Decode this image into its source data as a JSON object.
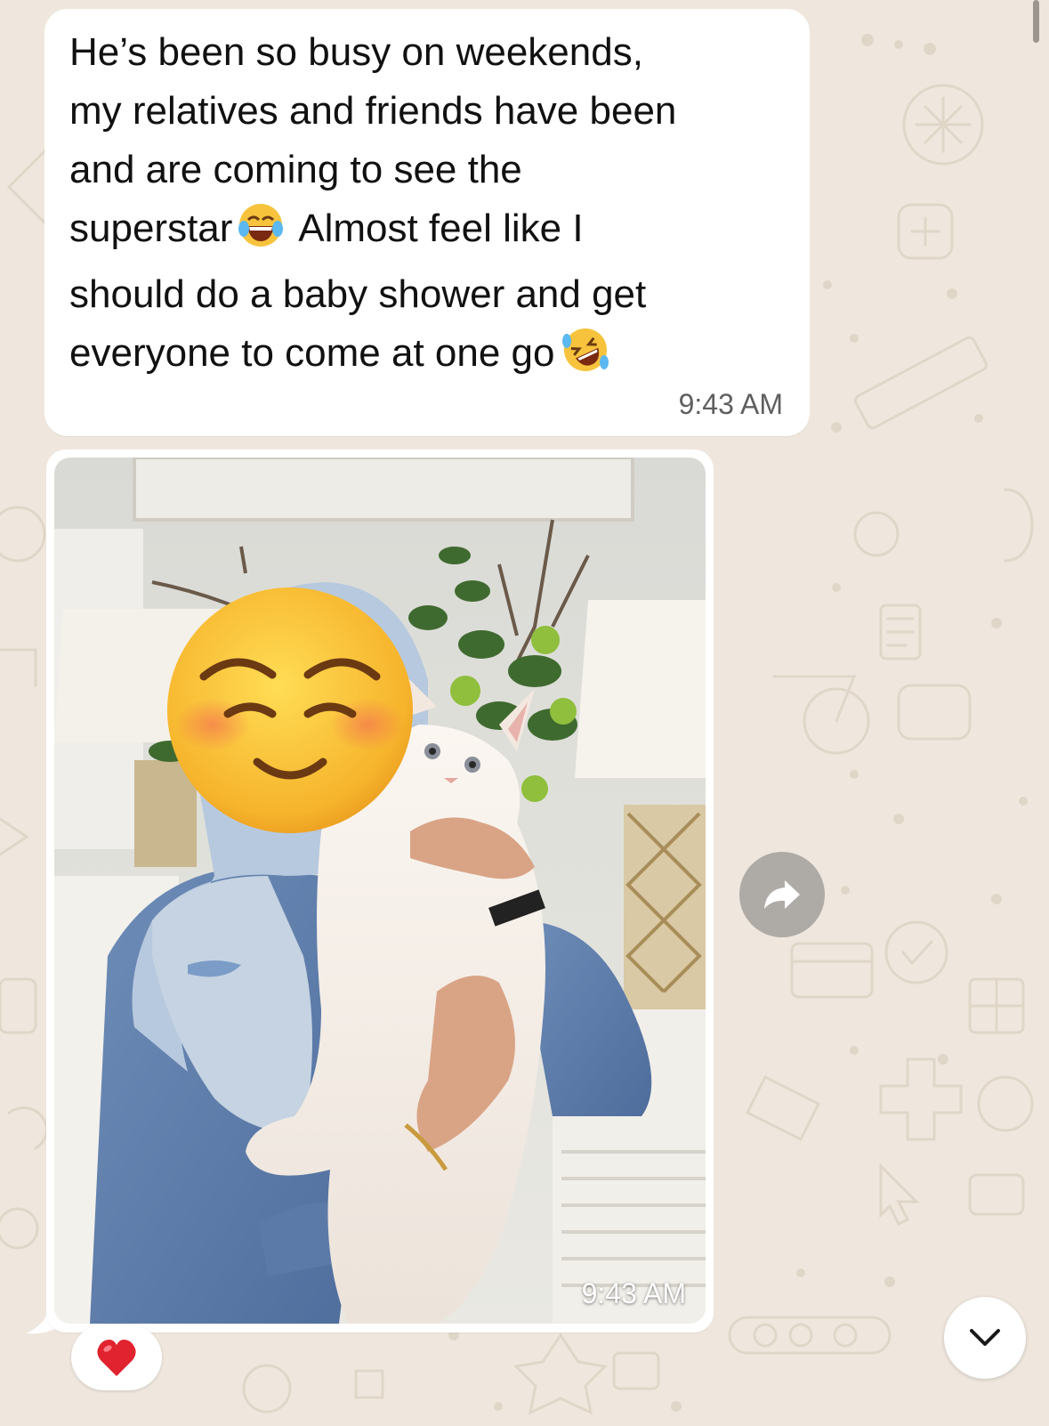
{
  "colors": {
    "wallpaper": "#efe7dd",
    "wallpaper_doodle": "#e3d9cc",
    "bubble": "#ffffff",
    "text": "#111111",
    "timestamp": "#5f5f5f",
    "reaction_heart": "#e0232e"
  },
  "messages": [
    {
      "type": "text",
      "parts": [
        "He’s been so busy on weekends,\nmy relatives and friends have been\nand are coming to see the\nsuperstar",
        " Almost feel like I\nshould do a baby shower and get\neveryone to come at one go"
      ],
      "emojis": [
        "tears-of-joy-emoji",
        "rolling-on-floor-laughing-emoji"
      ],
      "time": "9:43 AM"
    },
    {
      "type": "image",
      "image_description": "person holding white fluffy kitten, face covered by smiling-face emoji",
      "time": "9:43 AM"
    }
  ],
  "reaction": {
    "icon": "red-heart-icon"
  },
  "controls": {
    "forward_icon": "forward-arrow-icon",
    "scroll_icon": "chevron-down-icon"
  }
}
